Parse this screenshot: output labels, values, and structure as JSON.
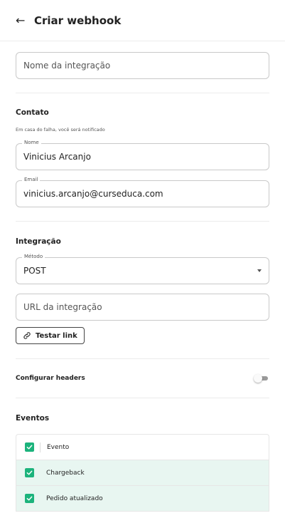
{
  "header": {
    "title": "Criar webhook"
  },
  "integration_name": {
    "placeholder": "Nome da integração"
  },
  "contact": {
    "title": "Contato",
    "hint": "Em casa do falha, você será notificado",
    "name": {
      "label": "Nome",
      "value": "Vinicius Arcanjo"
    },
    "email": {
      "label": "Email",
      "value": "vinicius.arcanjo@curseduca.com"
    }
  },
  "integration": {
    "title": "Integração",
    "method": {
      "label": "Método",
      "value": "POST"
    },
    "url": {
      "placeholder": "URL da integração"
    },
    "test_button": "Testar link"
  },
  "headers": {
    "label": "Configurar headers",
    "enabled": false
  },
  "events": {
    "title": "Eventos",
    "column_header": "Evento",
    "items": [
      {
        "label": "Chargeback",
        "checked": true
      },
      {
        "label": "Pedido atualizado",
        "checked": true
      }
    ]
  },
  "colors": {
    "accent": "#1cb37c",
    "selected_row": "#e8f6f1",
    "border": "#c9c9c9"
  },
  "icons": {
    "back": "arrow-left-icon",
    "link": "link-icon",
    "check": "check-icon",
    "caret": "caret-down-icon"
  }
}
